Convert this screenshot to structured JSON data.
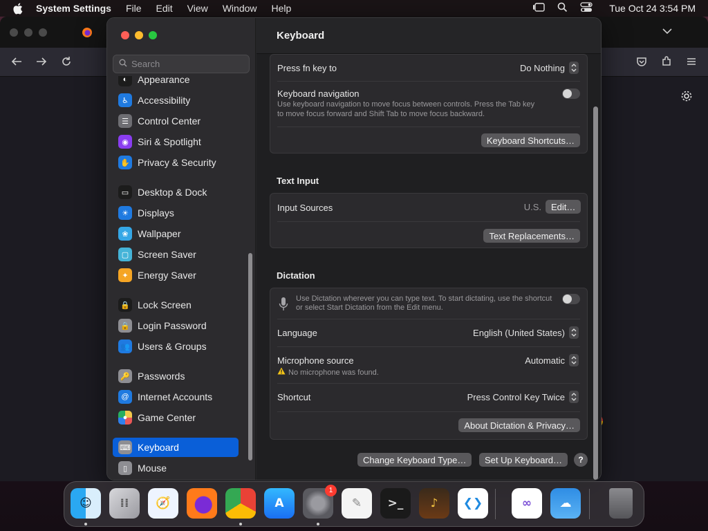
{
  "menubar": {
    "app_name": "System Settings",
    "menus": [
      "File",
      "Edit",
      "View",
      "Window",
      "Help"
    ],
    "clock": "Tue Oct 24  3:54 PM"
  },
  "sidebar": {
    "search_placeholder": "Search",
    "items": [
      {
        "label": "Appearance",
        "icon": "appearance-icon",
        "color": "#1c1c1c"
      },
      {
        "label": "Accessibility",
        "icon": "accessibility-icon",
        "color": "#1f7ae0"
      },
      {
        "label": "Control Center",
        "icon": "control-center-icon",
        "color": "#6e6e73"
      },
      {
        "label": "Siri & Spotlight",
        "icon": "siri-icon",
        "color": "#8a3df0"
      },
      {
        "label": "Privacy & Security",
        "icon": "privacy-hand-icon",
        "color": "#1f7ae0"
      },
      {
        "label": "Desktop & Dock",
        "icon": "desktop-dock-icon",
        "color": "#1c1c1c"
      },
      {
        "label": "Displays",
        "icon": "displays-icon",
        "color": "#1f7ae0"
      },
      {
        "label": "Wallpaper",
        "icon": "wallpaper-icon",
        "color": "#35a7e6"
      },
      {
        "label": "Screen Saver",
        "icon": "screen-saver-icon",
        "color": "#45b4d8"
      },
      {
        "label": "Energy Saver",
        "icon": "energy-saver-icon",
        "color": "#f5a524"
      },
      {
        "label": "Lock Screen",
        "icon": "lock-screen-icon",
        "color": "#1c1c1c"
      },
      {
        "label": "Login Password",
        "icon": "login-password-icon",
        "color": "#8e8e93"
      },
      {
        "label": "Users & Groups",
        "icon": "users-groups-icon",
        "color": "#1f7ae0"
      },
      {
        "label": "Passwords",
        "icon": "passwords-key-icon",
        "color": "#8e8e93"
      },
      {
        "label": "Internet Accounts",
        "icon": "internet-accounts-icon",
        "color": "#1f7ae0"
      },
      {
        "label": "Game Center",
        "icon": "game-center-icon",
        "color": "#e8e8e8"
      },
      {
        "label": "Keyboard",
        "icon": "keyboard-icon",
        "color": "#8e8e93",
        "selected": true
      },
      {
        "label": "Mouse",
        "icon": "mouse-icon",
        "color": "#8e8e93"
      }
    ]
  },
  "main": {
    "title": "Keyboard",
    "press_fn": {
      "label": "Press fn key to",
      "value": "Do Nothing"
    },
    "keyboard_nav": {
      "label": "Keyboard navigation",
      "description_1": "Use keyboard navigation to move focus between controls. Press the Tab key",
      "description_2": "to move focus forward and Shift Tab to move focus backward.",
      "enabled": false
    },
    "keyboard_shortcuts_button": "Keyboard Shortcuts…",
    "text_input": {
      "title": "Text Input",
      "input_sources_label": "Input Sources",
      "input_sources_value": "U.S.",
      "edit_button": "Edit…",
      "text_replacements_button": "Text Replacements…"
    },
    "dictation": {
      "title": "Dictation",
      "description_1": "Use Dictation wherever you can type text. To start dictating, use the shortcut",
      "description_2": "or select Start Dictation from the Edit menu.",
      "enabled": false,
      "language_label": "Language",
      "language_value": "English (United States)",
      "mic_label": "Microphone source",
      "mic_value": "Automatic",
      "mic_warning": "No microphone was found.",
      "shortcut_label": "Shortcut",
      "shortcut_value": "Press Control Key Twice",
      "about_button": "About Dictation & Privacy…"
    },
    "change_keyboard_type_button": "Change Keyboard Type…",
    "set_up_keyboard_button": "Set Up Keyboard…",
    "help_button": "?"
  },
  "dock": {
    "apps": [
      "finder-icon",
      "launchpad-icon",
      "safari-icon",
      "firefox-icon",
      "chrome-icon",
      "app-store-icon",
      "system-settings-icon",
      "textedit-icon",
      "terminal-icon",
      "garageband-icon",
      "vscode-icon",
      "visual-studio-icon",
      "weather-icon",
      "trash-icon"
    ],
    "settings_badge": "1"
  },
  "colors": {
    "accent": "#0a5fd8",
    "close": "#fe5f57",
    "minimize": "#febc2e",
    "maximize": "#28c840"
  }
}
